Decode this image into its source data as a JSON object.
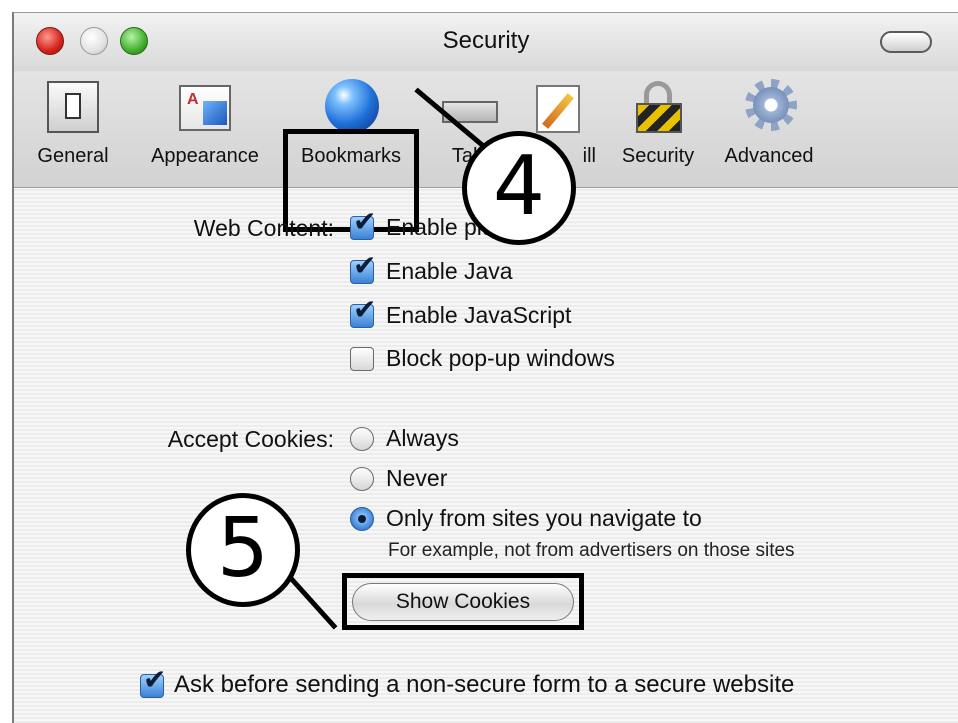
{
  "window": {
    "title": "Security"
  },
  "toolbar": {
    "items": [
      {
        "label": "General",
        "icon": "general-switch-icon"
      },
      {
        "label": "Appearance",
        "icon": "appearance-icon"
      },
      {
        "label": "Bookmarks",
        "icon": "globe-icon"
      },
      {
        "label": "Tabs",
        "icon": "tabs-icon"
      },
      {
        "label": "AutoFill",
        "icon": "autofill-pencil-icon"
      },
      {
        "label": "Security",
        "icon": "padlock-icon"
      },
      {
        "label": "Advanced",
        "icon": "gear-icon"
      }
    ],
    "visible_labels": {
      "tabs": "Tab",
      "autofill": "ill"
    }
  },
  "web_content": {
    "label": "Web Content:",
    "options": [
      {
        "label": "Enable plug-ins",
        "checked": true
      },
      {
        "label": "Enable Java",
        "checked": true
      },
      {
        "label": "Enable JavaScript",
        "checked": true
      },
      {
        "label": "Block pop-up windows",
        "checked": false
      }
    ]
  },
  "cookies": {
    "label": "Accept Cookies:",
    "options": [
      {
        "label": "Always",
        "selected": false
      },
      {
        "label": "Never",
        "selected": false
      },
      {
        "label": "Only from sites you navigate to",
        "selected": true
      }
    ],
    "hint": "For example, not from advertisers on those sites",
    "show_button": "Show Cookies"
  },
  "form_warning": {
    "label": "Ask before sending a non-secure form to a secure website",
    "checked": true
  },
  "callouts": {
    "step4": "4",
    "step5": "5"
  },
  "colors": {
    "accent": "#3b82d6",
    "callout": "#000000"
  }
}
